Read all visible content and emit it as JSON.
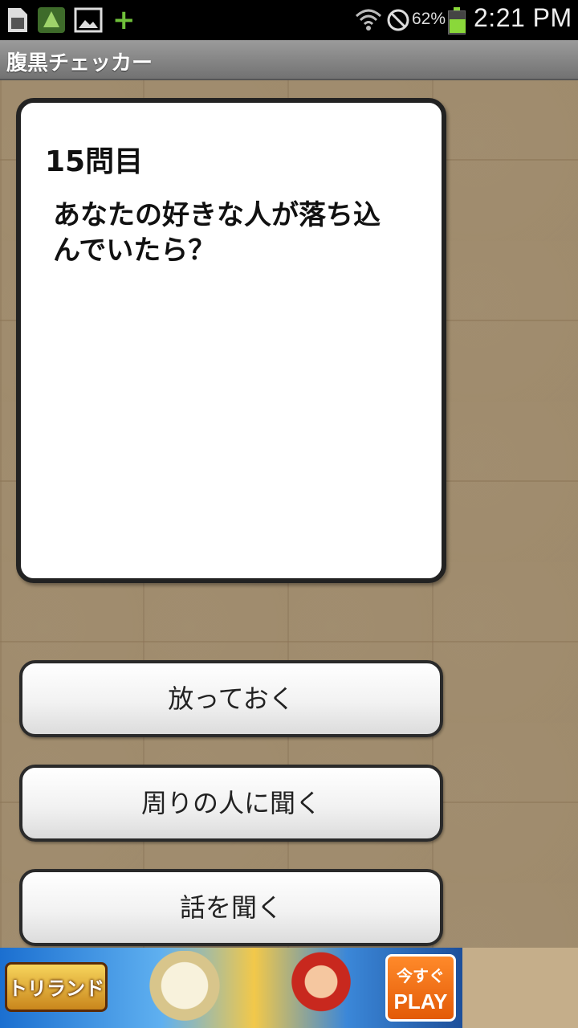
{
  "status_bar": {
    "battery_percent": "62%",
    "battery_level": 0.62,
    "time": "2:21 PM",
    "icons": [
      "sd-card-icon",
      "app-dragon-icon",
      "picture-icon",
      "plus-icon",
      "wifi-icon",
      "block-icon",
      "battery-icon"
    ]
  },
  "app": {
    "title": "腹黒チェッカー"
  },
  "question": {
    "number_label": "15問目",
    "text": "あなたの好きな人が落ち込んでいたら？"
  },
  "answers": [
    {
      "label": "放っておく"
    },
    {
      "label": "周りの人に聞く"
    },
    {
      "label": "話を聞く"
    }
  ],
  "ad": {
    "logo_text": "トリランド",
    "button_top": "今すぐ",
    "button_bottom": "PLAY"
  },
  "colors": {
    "background": "#c8b391",
    "card": "#ffffff",
    "border": "#222222",
    "title_bar": "#888888",
    "battery": "#8ad83a"
  }
}
